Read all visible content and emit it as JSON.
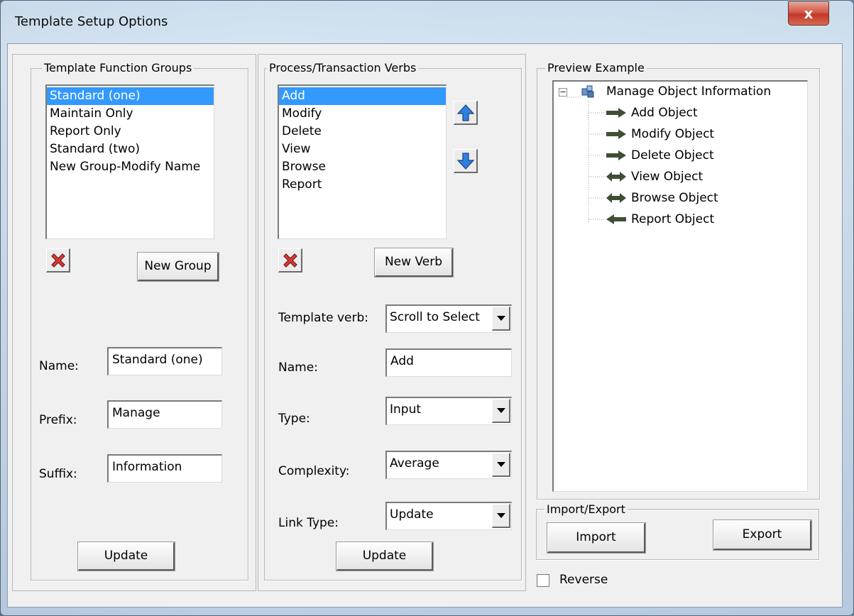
{
  "window": {
    "title": "Template Setup Options",
    "close_label": "x"
  },
  "groups": {
    "legend": "Template  Function Groups",
    "items": [
      "Standard  (one)",
      "Maintain Only",
      "Report Only",
      "Standard (two)",
      "New Group-Modify Name"
    ],
    "selected_index": 0,
    "new_group_label": "New Group",
    "name_label": "Name:",
    "name_value": "Standard  (one)",
    "prefix_label": "Prefix:",
    "prefix_value": "Manage",
    "suffix_label": "Suffix:",
    "suffix_value": "Information",
    "update_label": "Update"
  },
  "verbs": {
    "legend": "Process/Transaction Verbs",
    "items": [
      "Add",
      "Modify",
      "Delete",
      "View",
      "Browse",
      "Report"
    ],
    "selected_index": 0,
    "new_verb_label": "New Verb",
    "template_verb_label": "Template verb:",
    "template_verb_value": "Scroll to Select",
    "name_label": "Name:",
    "name_value": "Add",
    "type_label": "Type:",
    "type_value": "Input",
    "complexity_label": "Complexity:",
    "complexity_value": "Average",
    "link_type_label": "Link Type:",
    "link_type_value": "Update",
    "update_label": "Update"
  },
  "preview": {
    "legend": "Preview Example",
    "root": "Manage Object Information",
    "children": [
      {
        "label": "Add Object",
        "arrow": "right"
      },
      {
        "label": "Modify Object",
        "arrow": "right"
      },
      {
        "label": "Delete Object",
        "arrow": "right"
      },
      {
        "label": "View Object",
        "arrow": "both"
      },
      {
        "label": "Browse Object",
        "arrow": "both"
      },
      {
        "label": "Report Object",
        "arrow": "left"
      }
    ]
  },
  "import_export": {
    "legend": "Import/Export",
    "import_label": "Import",
    "export_label": "Export"
  },
  "reverse": {
    "label": "Reverse",
    "checked": false
  },
  "colors": {
    "selection": "#3399ff",
    "arrow": "#3f4f36",
    "delete_icon": "#d83b3b",
    "move_arrow": "#2f7fe0"
  }
}
